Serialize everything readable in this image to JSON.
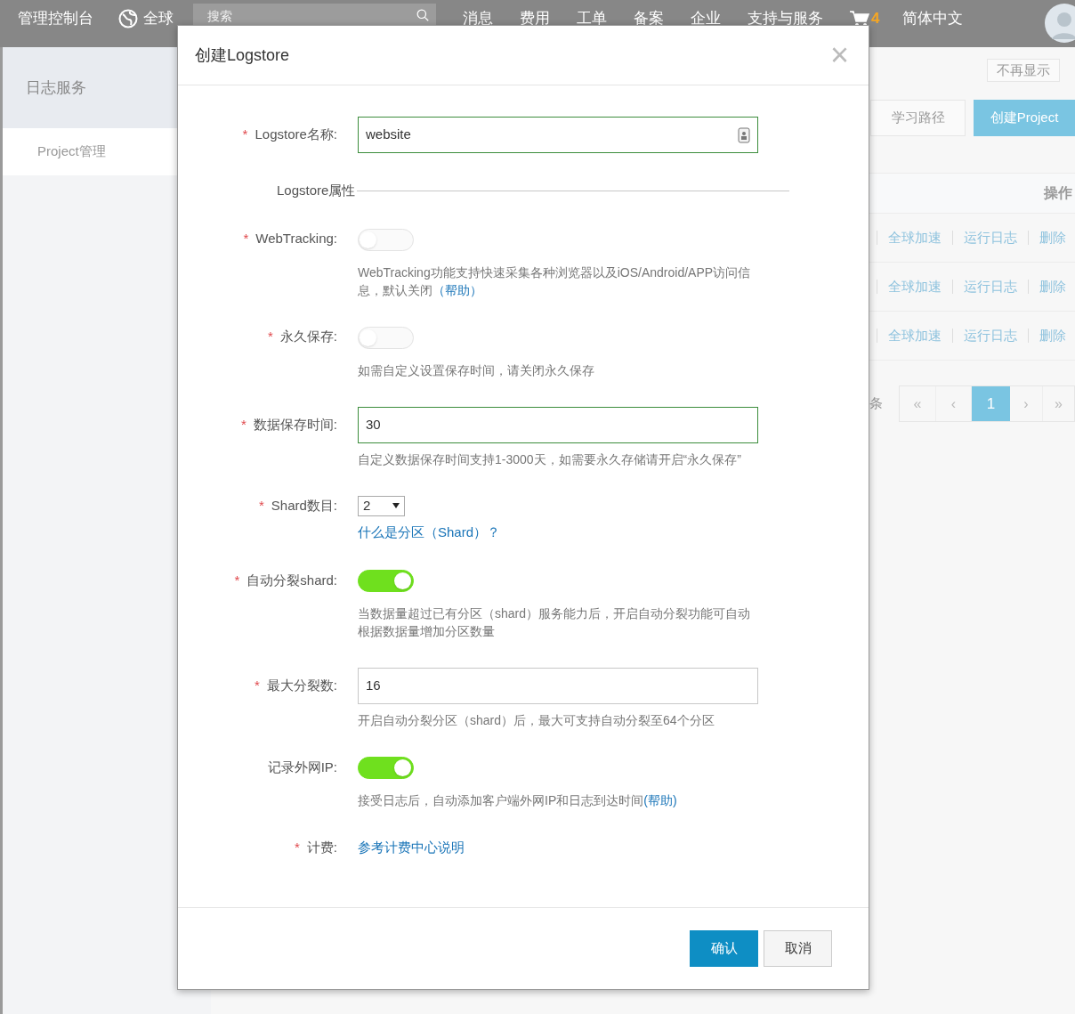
{
  "top_bar": {
    "brand": "管理控制台",
    "region": "全球",
    "search": {
      "placeholder": "搜索"
    },
    "nav": [
      "消息",
      "费用",
      "工单",
      "备案",
      "企业",
      "支持与服务"
    ],
    "cart_count": "4",
    "language": "简体中文"
  },
  "sidebar": {
    "title": "日志服务",
    "items": [
      {
        "label": "Project管理",
        "selected": true
      }
    ]
  },
  "main": {
    "dismiss_button": "不再显示",
    "buttons": [
      {
        "label": "学习路径",
        "kind": "plain"
      },
      {
        "label": "创建Project",
        "kind": "primary"
      }
    ],
    "table": {
      "column_header": "操作",
      "rows": [
        {
          "actions": [
            "全球加速",
            "运行日志",
            "删除"
          ]
        },
        {
          "actions": [
            "全球加速",
            "运行日志",
            "删除"
          ]
        },
        {
          "actions": [
            "全球加速",
            "运行日志",
            "删除"
          ]
        }
      ]
    },
    "pagination": {
      "summary": "条",
      "first": "«",
      "prev": "‹",
      "pages": [
        {
          "label": "1",
          "selected": true
        }
      ],
      "next": "›",
      "last": "»"
    }
  },
  "dialog": {
    "title": "创建Logstore",
    "close": "×",
    "rows": [
      {
        "kind": "input",
        "required_mark": "*",
        "label": "Logstore名称:",
        "value": "website",
        "focused": true
      },
      {
        "kind": "section",
        "label": "Logstore属性"
      },
      {
        "kind": "switch",
        "required_mark": "*",
        "label": "WebTracking:",
        "on": false,
        "help": "WebTracking功能支持快速采集各种浏览器以及iOS/Android/APP访问信息，默认关闭",
        "help_link": "（帮助）"
      },
      {
        "kind": "switch",
        "required_mark": "*",
        "label": "永久保存:",
        "on": false,
        "help": "如需自定义设置保存时间，请关闭永久保存"
      },
      {
        "kind": "input",
        "required_mark": "*",
        "label": "数据保存时间:",
        "value": "30",
        "focused": true,
        "help": "自定义数据保存时间支持1-3000天，如需要永久存储请开启“永久保存”"
      },
      {
        "kind": "select",
        "required_mark": "*",
        "label": "Shard数目:",
        "value": "2",
        "link": "什么是分区（Shard）？"
      },
      {
        "kind": "switch",
        "required_mark": "*",
        "label": "自动分裂shard:",
        "on": true,
        "help": "当数据量超过已有分区（shard）服务能力后，开启自动分裂功能可自动根据数据量增加分区数量"
      },
      {
        "kind": "input",
        "required_mark": "*",
        "label": "最大分裂数:",
        "value": "16",
        "focused": false,
        "help": "开启自动分裂分区（shard）后，最大可支持自动分裂至64个分区"
      },
      {
        "kind": "switch",
        "label": "记录外网IP:",
        "on": true,
        "help": "接受日志后，自动添加客户端外网IP和日志到达时间",
        "help_link": "(帮助)"
      },
      {
        "kind": "link",
        "required_mark": "*",
        "label": "计费:",
        "link": "参考计费中心说明"
      }
    ],
    "buttons": [
      {
        "label": "确认",
        "kind": "primary"
      },
      {
        "label": "取消",
        "kind": "plain"
      }
    ]
  }
}
